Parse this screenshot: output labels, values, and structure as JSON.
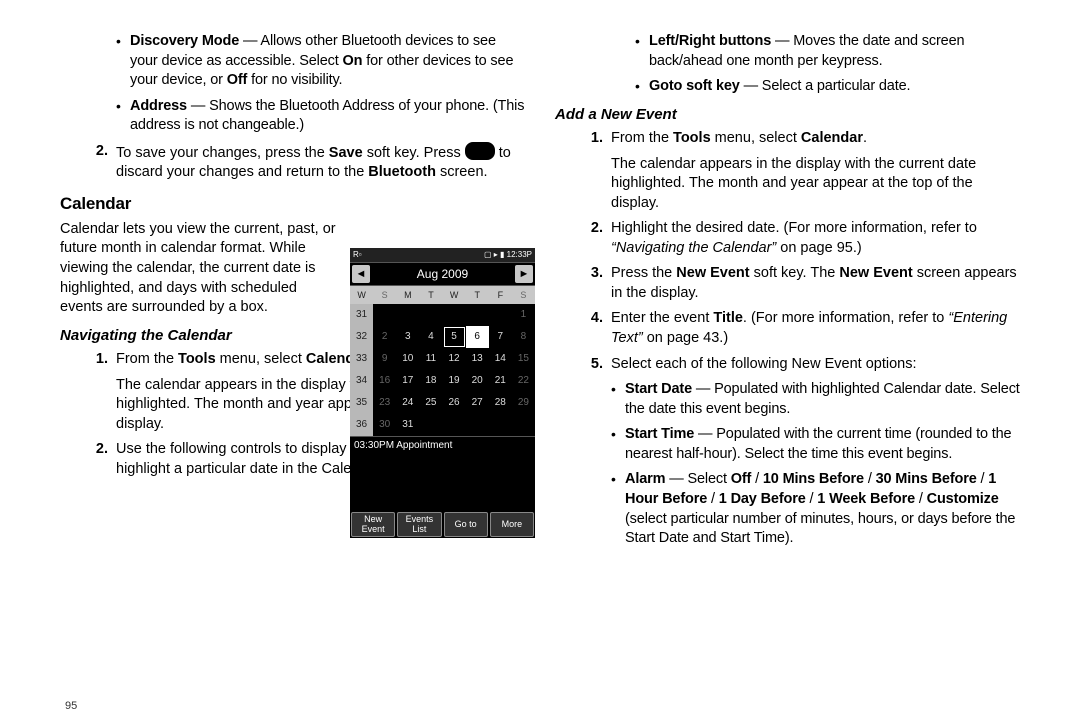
{
  "left": {
    "bullets_top": [
      {
        "plain": "Discovery Mode — Allows other Bluetooth devices to see your device as accessible. Select On for other devices to see your device, or Off for no visibility.",
        "html": "<b>Discovery Mode</b> — Allows other Bluetooth devices to see your device as accessible. Select <b>On</b> for other devices to see your device, or <b>Off</b> for no visibility."
      },
      {
        "plain": "Address — Shows the Bluetooth Address of your phone. (This address is not changeable.)",
        "html": "<b>Address</b> — Shows the Bluetooth Address of your phone. (This address is not changeable.)"
      }
    ],
    "step2": {
      "plain": "To save your changes, press the Save soft key. Press [key] to discard your changes and return to the Bluetooth screen.",
      "html_pre": "To save your changes, press the <b>Save</b> soft key. Press ",
      "html_post": " to discard your changes and return to the <b>Bluetooth</b> screen."
    },
    "calendar_heading": "Calendar",
    "calendar_intro": "Calendar lets you view the current, past, or future month in calendar format. While viewing the calendar, the current date is highlighted, and days with scheduled events are surrounded by a box.",
    "nav_heading": "Navigating the Calendar",
    "nav_steps": {
      "s1_html": "From the <b>Tools</b> menu, select <b>Calendar</b>.",
      "s1_p2": "The calendar appears in the display with the current date highlighted. The month and year appear at the top of the display.",
      "s2": "Use the following controls to display a particular month and to highlight a particular date in the Calendar screen:"
    },
    "page_num": "95"
  },
  "right": {
    "bullets_top": [
      {
        "html": "<b>Left/Right buttons</b> — Moves the date and screen back/ahead one month per keypress."
      },
      {
        "html": "<b>Goto soft key</b> — Select a particular date."
      }
    ],
    "add_heading": "Add a New Event",
    "steps": [
      {
        "n": "1.",
        "html": "From the <b>Tools</b> menu, select <b>Calendar</b>.",
        "p2": "The calendar appears in the display with the current date highlighted. The month and year appear at the top of the display."
      },
      {
        "n": "2.",
        "html": "Highlight the desired date. (For more information, refer to <i>“Navigating the Calendar”</i>  on page 95.)"
      },
      {
        "n": "3.",
        "html": "Press the <b>New Event</b> soft key. The <b>New Event</b> screen appears in the display."
      },
      {
        "n": "4.",
        "html": "Enter the event <b>Title</b>. (For more information, refer to <i>“Entering Text”</i>  on page 43.)"
      },
      {
        "n": "5.",
        "html": "Select each of the following New Event options:"
      }
    ],
    "opt_bullets": [
      {
        "html": "<b>Start Date</b> — Populated with highlighted Calendar date. Select the date this event begins."
      },
      {
        "html": "<b>Start Time</b> — Populated with the current time (rounded to the nearest half-hour). Select the time this event begins."
      },
      {
        "html": "<b>Alarm</b> — Select <b>Off</b> / <b>10 Mins Before</b> / <b>30 Mins Before</b> / <b>1 Hour Before</b> / <b>1 Day Before</b> / <b>1 Week Before</b> / <b>Customize</b> (select particular number of minutes, hours, or days before the Start Date and Start Time)."
      }
    ]
  },
  "phone": {
    "status_left": "R▫",
    "status_right": "▢ ▸ ▮ 12:33P",
    "title": "Aug 2009",
    "dow": [
      "W",
      "S",
      "M",
      "T",
      "W",
      "T",
      "F",
      "S"
    ],
    "rows": [
      {
        "wk": "31",
        "d": [
          "",
          "",
          "",
          "",
          "",
          "",
          "1"
        ]
      },
      {
        "wk": "32",
        "d": [
          "2",
          "3",
          "4",
          "5",
          "6",
          "7",
          "8"
        ],
        "sel": 4,
        "box": 3
      },
      {
        "wk": "33",
        "d": [
          "9",
          "10",
          "11",
          "12",
          "13",
          "14",
          "15"
        ]
      },
      {
        "wk": "34",
        "d": [
          "16",
          "17",
          "18",
          "19",
          "20",
          "21",
          "22"
        ]
      },
      {
        "wk": "35",
        "d": [
          "23",
          "24",
          "25",
          "26",
          "27",
          "28",
          "29"
        ]
      },
      {
        "wk": "36",
        "d": [
          "30",
          "31",
          "",
          "",
          "",
          "",
          ""
        ]
      }
    ],
    "event": "03:30PM Appointment",
    "softkeys": [
      "New\nEvent",
      "Events\nList",
      "Go to",
      "More"
    ]
  }
}
